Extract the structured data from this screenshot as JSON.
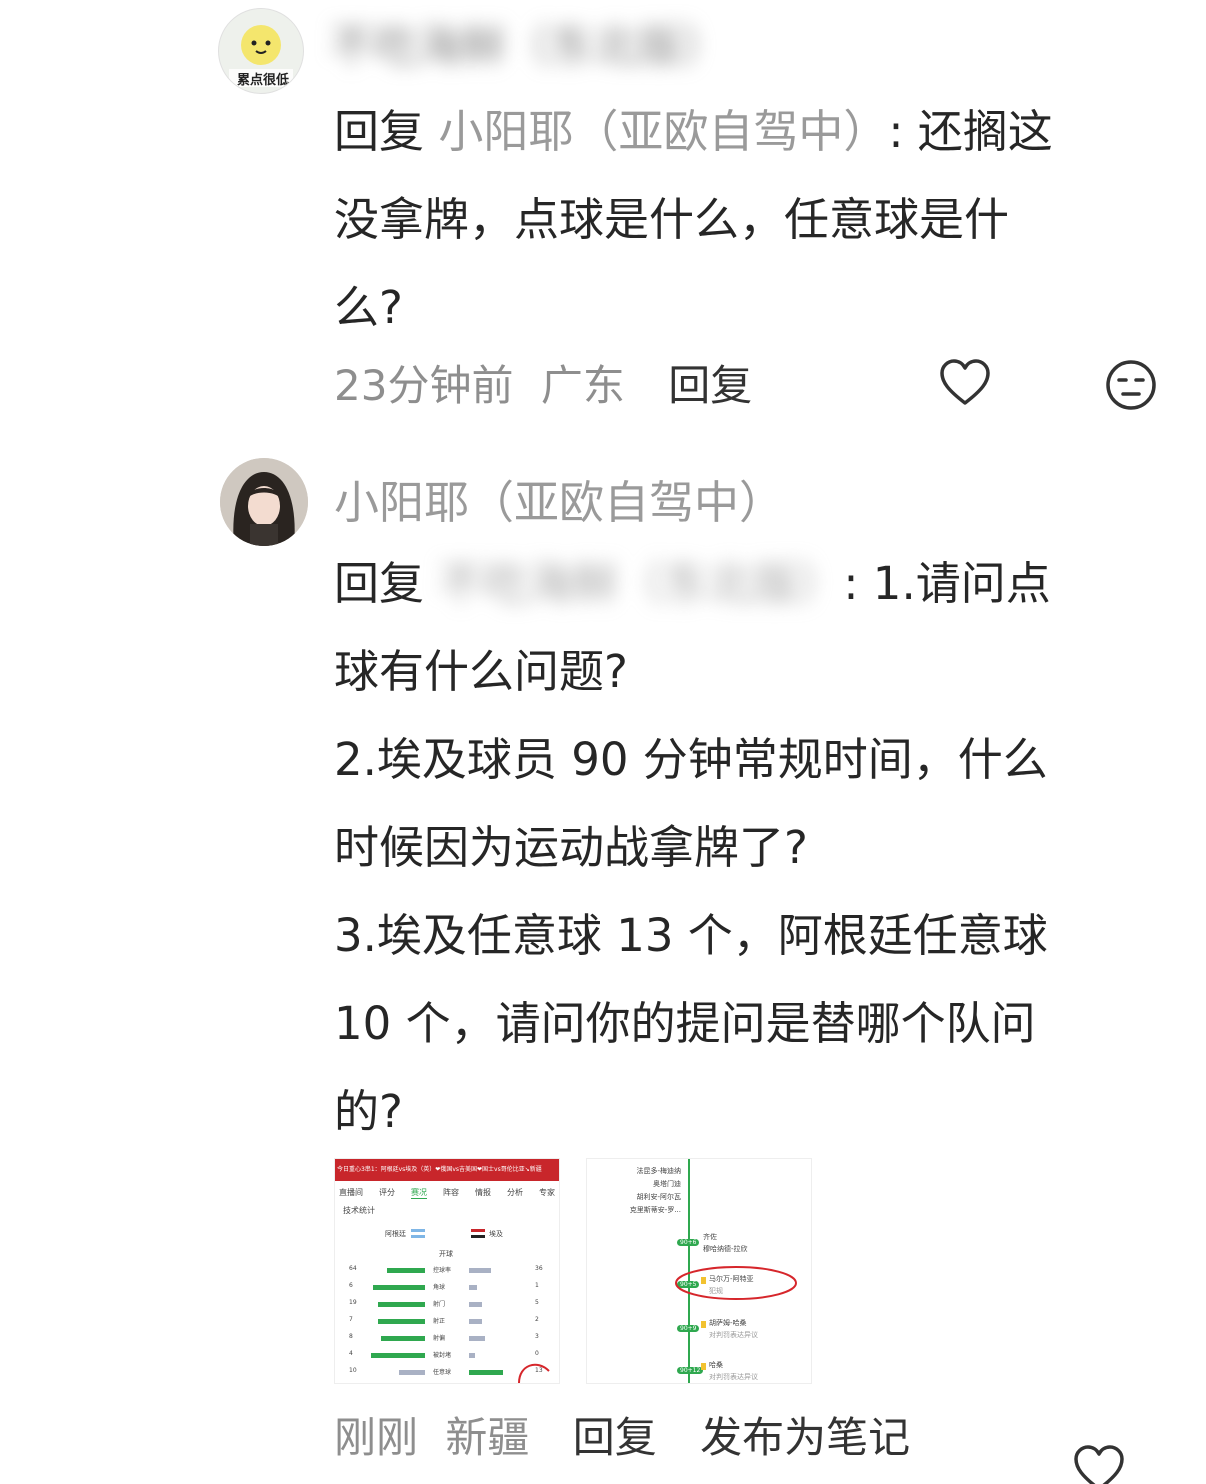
{
  "comment1": {
    "username_blurred": "不吃海鲜（东北版）",
    "avatar_caption": "累点很低",
    "reply_prefix": "回复",
    "reply_target": "小阳耶（亚欧自驾中）",
    "text_line1": ": 还搁这",
    "text_line2": "没拿牌，点球是什么，任意球是什",
    "text_line3": "么?",
    "time": "23分钟前",
    "location": "广东",
    "reply_label": "回复"
  },
  "comment2": {
    "username": "小阳耶（亚欧自驾中）",
    "reply_prefix": "回复",
    "reply_target_blurred": "不吃海鲜（东北版）",
    "lines": [
      ": 1.请问点",
      "球有什么问题?",
      "2.埃及球员 90 分钟常规时间，什么",
      "时候因为运动战拿牌了?",
      "3.埃及任意球 13 个，阿根廷任意球",
      "10 个，请问你的提问是替哪个队问",
      "的?"
    ],
    "time": "刚刚",
    "location": "新疆",
    "reply_label": "回复",
    "publish_label": "发布为笔记"
  },
  "screenshot1": {
    "banner": "今日重心3串1：阿根廷vs埃及（英）❤俄国vs吉美国❤国士vs哥伦比亚↘新疆",
    "tabs": [
      "直播间",
      "评分",
      "赛况",
      "阵容",
      "情报",
      "分析",
      "专家"
    ],
    "subtitle": "技术统计",
    "team_left": "阿根廷",
    "team_right": "埃及",
    "kickoff": "开球",
    "stats": [
      {
        "label": "控球率",
        "left": "64",
        "right": "36",
        "l": 0.64,
        "r": 0.36
      },
      {
        "label": "角球",
        "left": "6",
        "right": "1",
        "l": 0.86,
        "r": 0.14
      },
      {
        "label": "射门",
        "left": "19",
        "right": "5",
        "l": 0.79,
        "r": 0.21
      },
      {
        "label": "射正",
        "left": "7",
        "right": "2",
        "l": 0.78,
        "r": 0.22
      },
      {
        "label": "射偏",
        "left": "8",
        "right": "3",
        "l": 0.73,
        "r": 0.27
      },
      {
        "label": "被封堵",
        "left": "4",
        "right": "0",
        "l": 0.9,
        "r": 0.1
      },
      {
        "label": "任意球",
        "left": "10",
        "right": "13",
        "l": 0.43,
        "r": 0.57
      }
    ]
  },
  "screenshot2": {
    "top_events": [
      "法昆多-梅迪纳",
      "奥塔门迪",
      "胡利安-阿尔瓦",
      "克里斯蒂安-罗..."
    ],
    "events": [
      {
        "minute": "90+6",
        "lines": [
          "齐佐",
          "穆哈纳德-拉欣"
        ]
      },
      {
        "minute": "90+5",
        "lines": [
          "马尔万-阿特亚",
          "犯规"
        ],
        "circled": true
      },
      {
        "minute": "90+9",
        "lines": [
          "胡萨姆-哈桑",
          "对判罚表达异议"
        ]
      },
      {
        "minute": "90+12",
        "lines": [
          "哈桑",
          "对判罚表达异议"
        ]
      }
    ]
  },
  "colors": {
    "green": "#2fa84f",
    "red_banner": "#c8262b",
    "grey_bar": "#a9b1c4",
    "circle": "#d6262b"
  }
}
